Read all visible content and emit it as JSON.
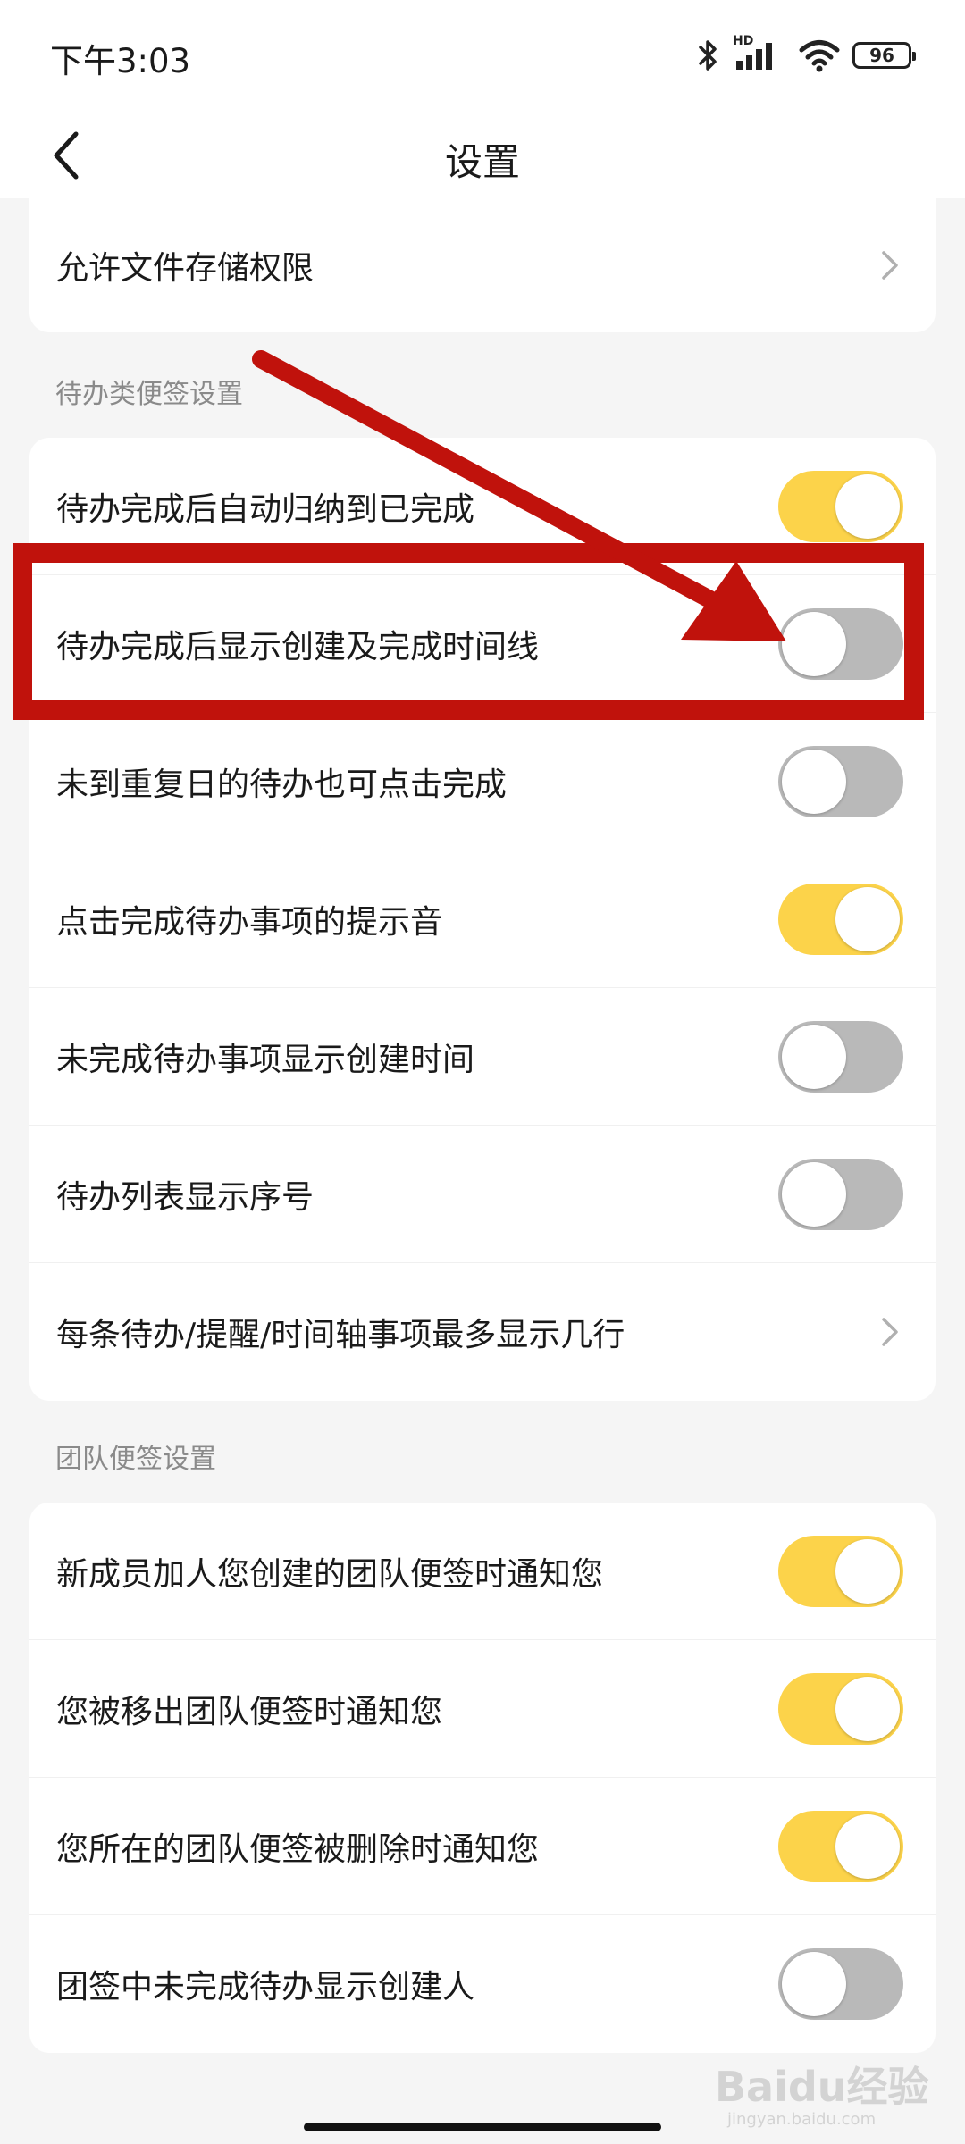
{
  "status_bar": {
    "time": "下午3:03",
    "hd_label": "HD",
    "battery": "96"
  },
  "nav": {
    "title": "设置"
  },
  "storage_card": {
    "label": "允许文件存储权限"
  },
  "todo_section": {
    "header": "待办类便签设置",
    "rows": [
      {
        "label": "待办完成后自动归纳到已完成",
        "on": true
      },
      {
        "label": "待办完成后显示创建及完成时间线",
        "on": false
      },
      {
        "label": "未到重复日的待办也可点击完成",
        "on": false
      },
      {
        "label": "点击完成待办事项的提示音",
        "on": true
      },
      {
        "label": "未完成待办事项显示创建时间",
        "on": false
      },
      {
        "label": "待办列表显示序号",
        "on": false
      },
      {
        "label": "每条待办/提醒/时间轴事项最多显示几行",
        "chevron": true
      }
    ]
  },
  "team_section": {
    "header": "团队便签设置",
    "rows": [
      {
        "label": "新成员加人您创建的团队便签时通知您",
        "on": true
      },
      {
        "label": "您被移出团队便签时通知您",
        "on": true
      },
      {
        "label": "您所在的团队便签被删除时通知您",
        "on": true
      },
      {
        "label": "团签中未完成待办显示创建人",
        "on": false
      }
    ]
  },
  "watermark": {
    "brand": "Baidu经验",
    "url": "jingyan.baidu.com"
  },
  "colors": {
    "toggle_on": "#fcd34a",
    "toggle_off": "#b9b9b9",
    "annotation": "#c0120c"
  }
}
